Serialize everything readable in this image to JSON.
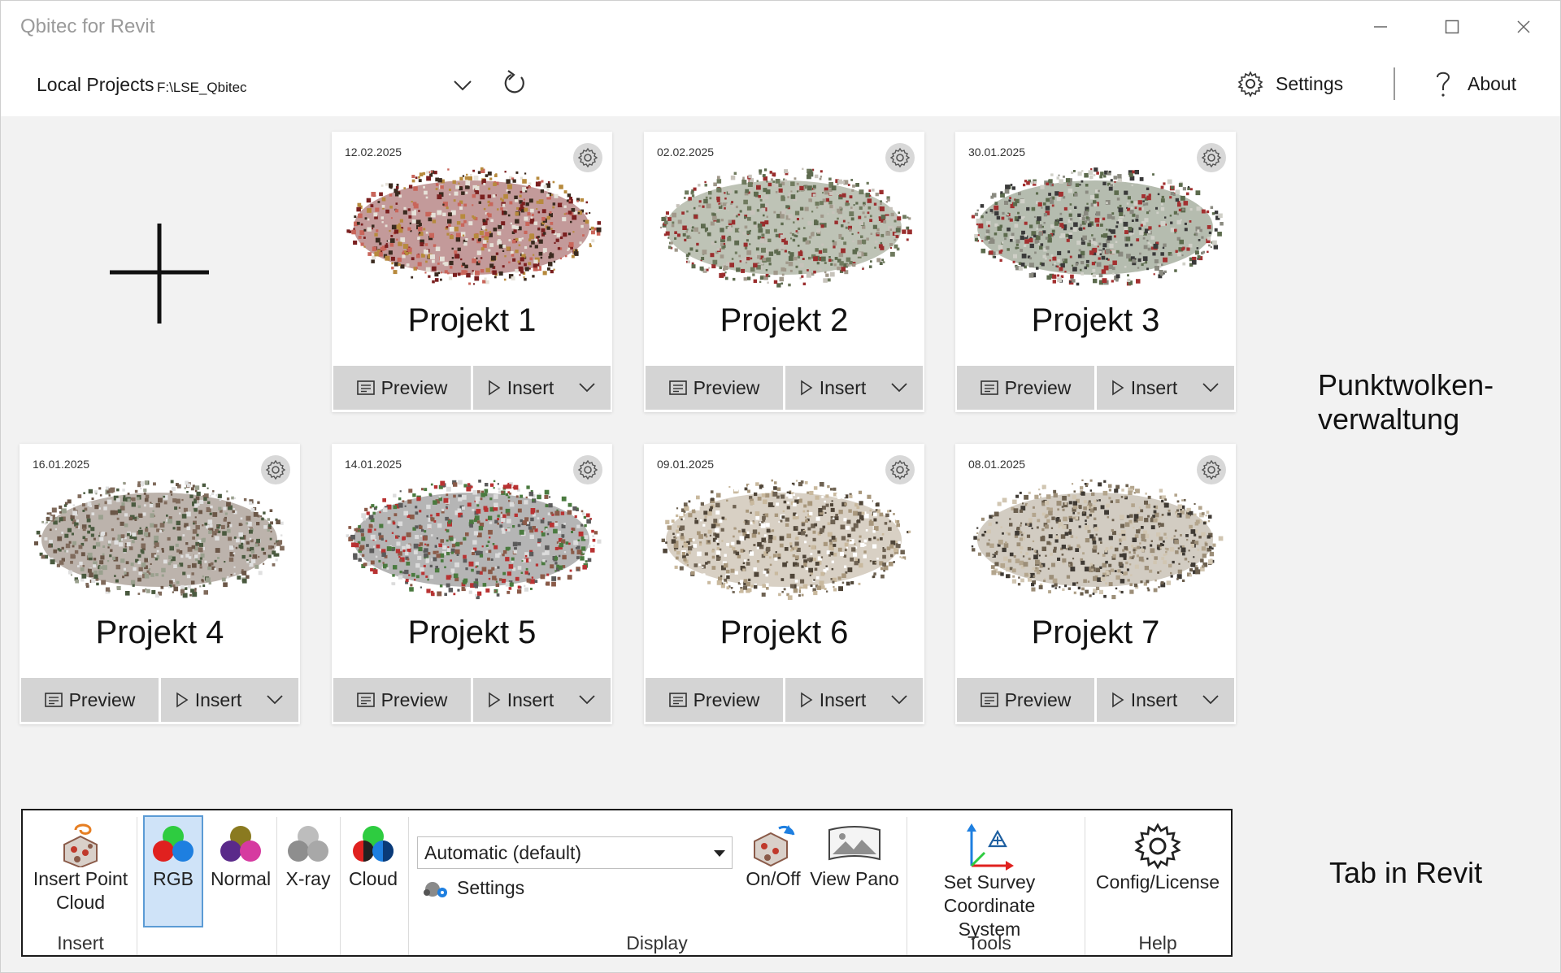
{
  "window": {
    "title": "Qbitec for Revit"
  },
  "topbar": {
    "projects_label": "Local Projects",
    "projects_path": "F:\\LSE_Qbitec",
    "settings_label": "Settings",
    "about_label": "About"
  },
  "cards": [
    {
      "name": "Projekt 1",
      "date": "12.02.2025",
      "preview": "Preview",
      "insert": "Insert",
      "palette": [
        "#7a1f1f",
        "#c9655a",
        "#e6e2d9",
        "#3a2a1f",
        "#b78a3d"
      ]
    },
    {
      "name": "Projekt 2",
      "date": "02.02.2025",
      "preview": "Preview",
      "insert": "Insert",
      "palette": [
        "#6f7a5e",
        "#a0988a",
        "#9a2d2d",
        "#c7c3bb",
        "#5d6a4e"
      ]
    },
    {
      "name": "Projekt 3",
      "date": "30.01.2025",
      "preview": "Preview",
      "insert": "Insert",
      "palette": [
        "#5c6b4d",
        "#a33030",
        "#d0d0c8",
        "#3a3a3a",
        "#8a8a80"
      ]
    },
    {
      "name": "Projekt 4",
      "date": "16.01.2025",
      "preview": "Preview",
      "insert": "Insert",
      "palette": [
        "#6b5748",
        "#9aa08e",
        "#e0e0e0",
        "#4a5a3f",
        "#806b5c"
      ]
    },
    {
      "name": "Projekt 5",
      "date": "14.01.2025",
      "preview": "Preview",
      "insert": "Insert",
      "palette": [
        "#5b5b5b",
        "#4a7a3f",
        "#8a5a48",
        "#b83232",
        "#dcdcdc"
      ]
    },
    {
      "name": "Projekt 6",
      "date": "09.01.2025",
      "preview": "Preview",
      "insert": "Insert",
      "palette": [
        "#a8977c",
        "#6e6252",
        "#c9b99e",
        "#4f4538",
        "#ffffff"
      ]
    },
    {
      "name": "Projekt 7",
      "date": "08.01.2025",
      "preview": "Preview",
      "insert": "Insert",
      "palette": [
        "#9c8e78",
        "#b3a58d",
        "#6b5f4e",
        "#3f3a34",
        "#d1c6b2"
      ]
    }
  ],
  "side_notes": {
    "cloud_management": "Punktwolken- verwaltung",
    "tab_in_revit": "Tab in Revit"
  },
  "ribbon": {
    "insert_point_cloud": "Insert Point Cloud",
    "rgb": "RGB",
    "normal": "Normal",
    "xray": "X-ray",
    "cloud": "Cloud",
    "display_mode": "Automatic (default)",
    "display_settings": "Settings",
    "onoff": "On/Off",
    "view_pano": "View Pano",
    "set_survey": "Set Survey Coordinate System",
    "config_license": "Config/License",
    "groups": {
      "insert": "Insert",
      "display": "Display",
      "tools": "Tools",
      "help": "Help"
    }
  },
  "colors": {
    "accent_selected": "#cfe3f8",
    "button_bg": "#d4d4d4",
    "card_bg": "#ffffff",
    "window_bg": "#f2f2f2"
  }
}
